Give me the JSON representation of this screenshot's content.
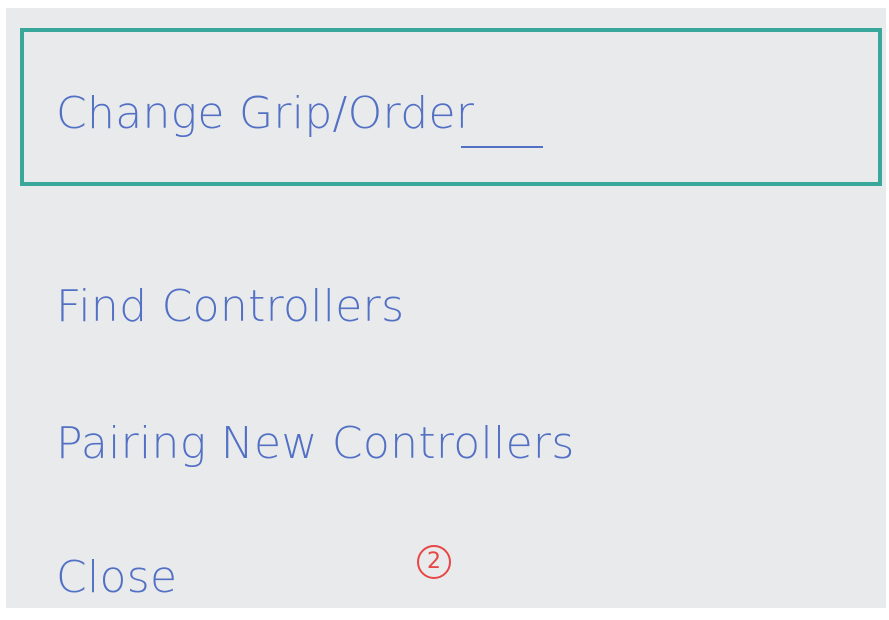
{
  "menu": {
    "items": [
      {
        "label": "Change Grip/Order",
        "selected": true
      },
      {
        "label": "Find Controllers",
        "selected": false
      },
      {
        "label": "Pairing New Controllers",
        "selected": false
      },
      {
        "label": "Close",
        "selected": false
      }
    ]
  },
  "annotation": {
    "marker": "2"
  },
  "colors": {
    "panel_background": "#e9eaec",
    "item_text": "#5270c4",
    "selection_border": "#3aa79b",
    "marker": "#e74747"
  }
}
